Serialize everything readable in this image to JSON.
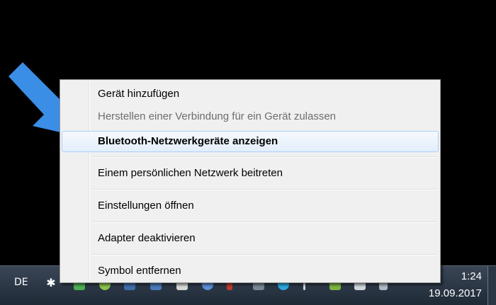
{
  "menu": {
    "items": [
      {
        "label": "Gerät hinzufügen"
      },
      {
        "label": "Herstellen einer Verbindung für ein Gerät zulassen"
      },
      {
        "label": "Bluetooth-Netzwerkgeräte anzeigen"
      },
      {
        "label": "Einem persönlichen Netzwerk beitreten"
      },
      {
        "label": "Einstellungen öffnen"
      },
      {
        "label": "Adapter deaktivieren"
      },
      {
        "label": "Symbol entfernen"
      }
    ]
  },
  "taskbar": {
    "language": "DE",
    "time": "1:24",
    "date": "19.09.2017"
  },
  "colors": {
    "arrow": "#3b8ee6",
    "menu_background": "#f0f0f0",
    "hover_border": "#aecff7"
  }
}
